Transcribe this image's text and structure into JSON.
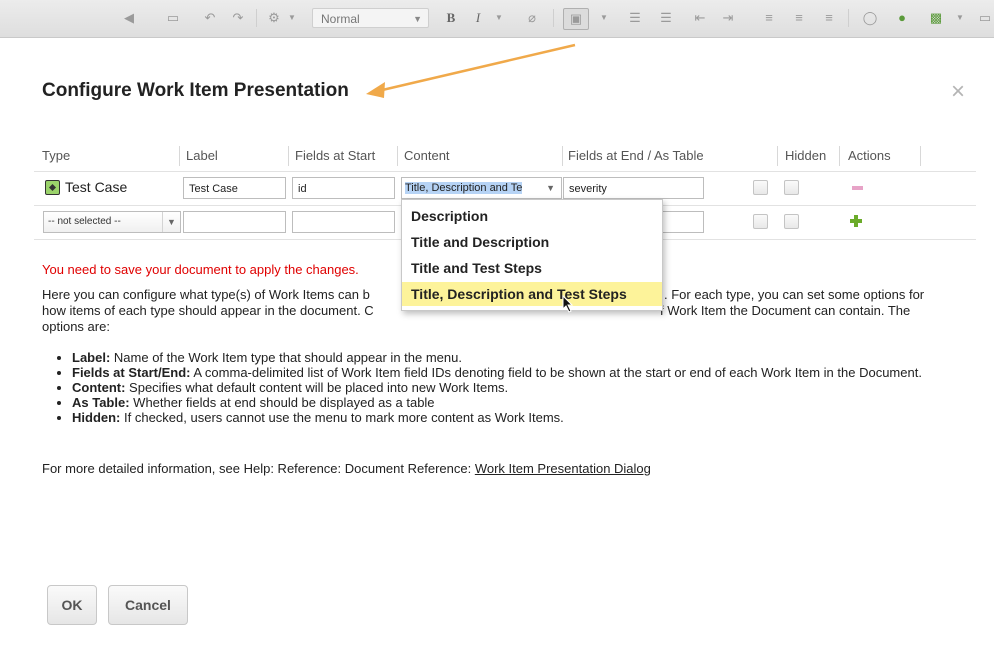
{
  "toolbar": {
    "style_select_value": "Normal",
    "bold_label": "B",
    "italic_label": "I"
  },
  "dialog": {
    "title": "Configure Work Item Presentation",
    "close_glyph": "×"
  },
  "table": {
    "headers": {
      "type": "Type",
      "label": "Label",
      "fields_at_start": "Fields at Start",
      "content": "Content",
      "fields_at_end": "Fields at End / As Table",
      "hidden": "Hidden",
      "actions": "Actions"
    },
    "row1": {
      "type": "Test Case",
      "label": "Test Case",
      "fields_at_start": "id",
      "content_prefix": "Title, Description and Te",
      "fields_at_end": "severity"
    },
    "row2": {
      "type_select": "-- not selected --"
    }
  },
  "dropdown": {
    "options": [
      "Description",
      "Title and Description",
      "Title and Test Steps",
      "Title, Description and Test Steps"
    ],
    "selected_index": 3
  },
  "body": {
    "warning": "You need to save your document to apply the changes.",
    "intro_line1_a": "Here you can configure what type(s) of Work Items can b",
    "intro_line1_b": ". For each type, you can set some options for",
    "intro_line2_a": "how items of each type should appear in the document. C",
    "intro_line2_b": "f Work Item the Document can contain. The",
    "intro_line3": "options are:",
    "bullets": [
      {
        "term": "Label:",
        "text": " Name of the Work Item type that should appear in the menu."
      },
      {
        "term": "Fields at Start/End:",
        "text": " A comma-delimited list of Work Item field IDs denoting field to be shown at the start or end of each Work Item in the Document."
      },
      {
        "term": "Content:",
        "text": " Specifies what default content will be placed into new Work Items."
      },
      {
        "term": "As Table:",
        "text": " Whether fields at end should be displayed as a table"
      },
      {
        "term": "Hidden:",
        "text": " If checked, users cannot use the menu to mark more content as Work Items."
      }
    ],
    "more_info": "For more detailed information, see Help: Reference: Document Reference: ",
    "more_info_link": "Work Item Presentation Dialog"
  },
  "buttons": {
    "ok": "OK",
    "cancel": "Cancel"
  },
  "colors": {
    "warning": "#e00000",
    "selected_option": "#fdf39a",
    "arrow": "#f0a94a",
    "add": "#6bab2a",
    "remove": "#e7a3c7"
  }
}
